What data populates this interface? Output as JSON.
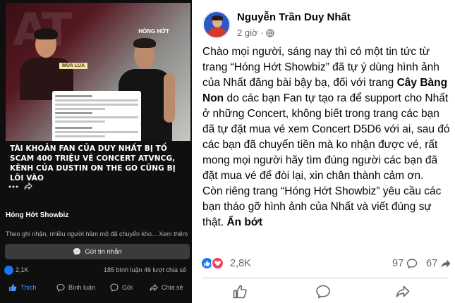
{
  "left_panel": {
    "photo_watermark": "HÓNG HỚT",
    "photo_label": "MÙA LÚA",
    "headline": "TÀI KHOẢN FAN CỦA DUY NHẤT BỊ TỐ SCAM 400 TRIỆU VÉ CONCERT ATVNCG, KÊNH CỦA DUSTIN ON THE GO CŨNG BỊ LÔI VÀO",
    "page_name": "Hóng Hớt Showbiz",
    "caption": "Theo ghi nhận, nhiều người hâm mộ đã chuyển kho...",
    "see_more": "Xem thêm",
    "message_button": "Gửi tin nhắn",
    "likes": "2,1K",
    "comments": "185 bình luận",
    "shares": "46 lượt chia sẻ",
    "actions": {
      "like": "Thích",
      "comment": "Bình luận",
      "send": "Gửi",
      "share": "Chia sẻ"
    }
  },
  "post": {
    "author": "Nguyễn Trần Duy Nhất",
    "time": "2 giờ ·",
    "text_part1": "Chào mọi người, sáng nay thì có một tin tức từ trang “Hóng Hớt Showbiz” đã tự ý dùng hình ảnh của Nhất đăng bài bậy bạ, đối với trang ",
    "text_bold": "Cây Bàng Non",
    "text_part2": " do các bạn Fan tự tạo ra để support cho Nhất ở những Concert, không biết trong trang các bạn đã tự đặt mua vé xem Concert D5D6 với ai, sau đó các bạn đã chuyển tiền mà ko nhận được vé, rất mong mọi người hãy tìm đúng người các bạn đã đặt mua vé để đòi lại, xin chân thành cảm ơn.",
    "text_part3": "Còn riêng trang “Hóng Hớt Showbiz” yêu cầu các bạn tháo gỡ hình ảnh của Nhất và viết đúng sự thật. ",
    "show_less": "Ẩn bớt",
    "reactions": "2,8K",
    "comment_count": "97",
    "share_count": "67"
  },
  "colors": {
    "facebook_blue": "#1877f2",
    "love_red": "#f33e58",
    "dark_bg": "#0f0f10"
  }
}
